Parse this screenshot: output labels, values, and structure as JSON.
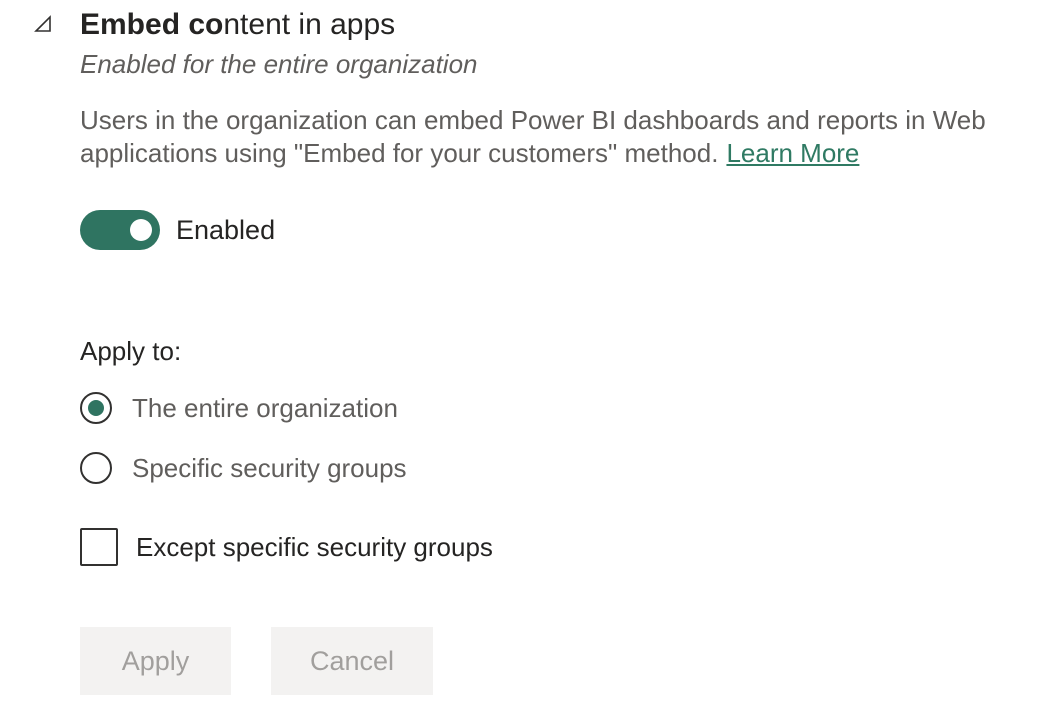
{
  "section": {
    "title_bold": "Embed co",
    "title_rest": "ntent in apps",
    "subtitle": "Enabled for the entire organization",
    "description_line1": "Users in the organization can embed Power BI dashboards and reports in Web",
    "description_line2": "applications using \"Embed for your customers\" method.",
    "learn_more": "Learn More"
  },
  "toggle": {
    "label": "Enabled",
    "on": true,
    "color": "#2f7461"
  },
  "apply_to": {
    "label": "Apply to:",
    "options": [
      {
        "label": "The entire organization",
        "checked": true
      },
      {
        "label": "Specific security groups",
        "checked": false
      }
    ]
  },
  "except": {
    "label": "Except specific security groups",
    "checked": false
  },
  "buttons": {
    "apply": "Apply",
    "cancel": "Cancel"
  },
  "icons": {
    "collapse": "triangle-collapse-icon"
  }
}
